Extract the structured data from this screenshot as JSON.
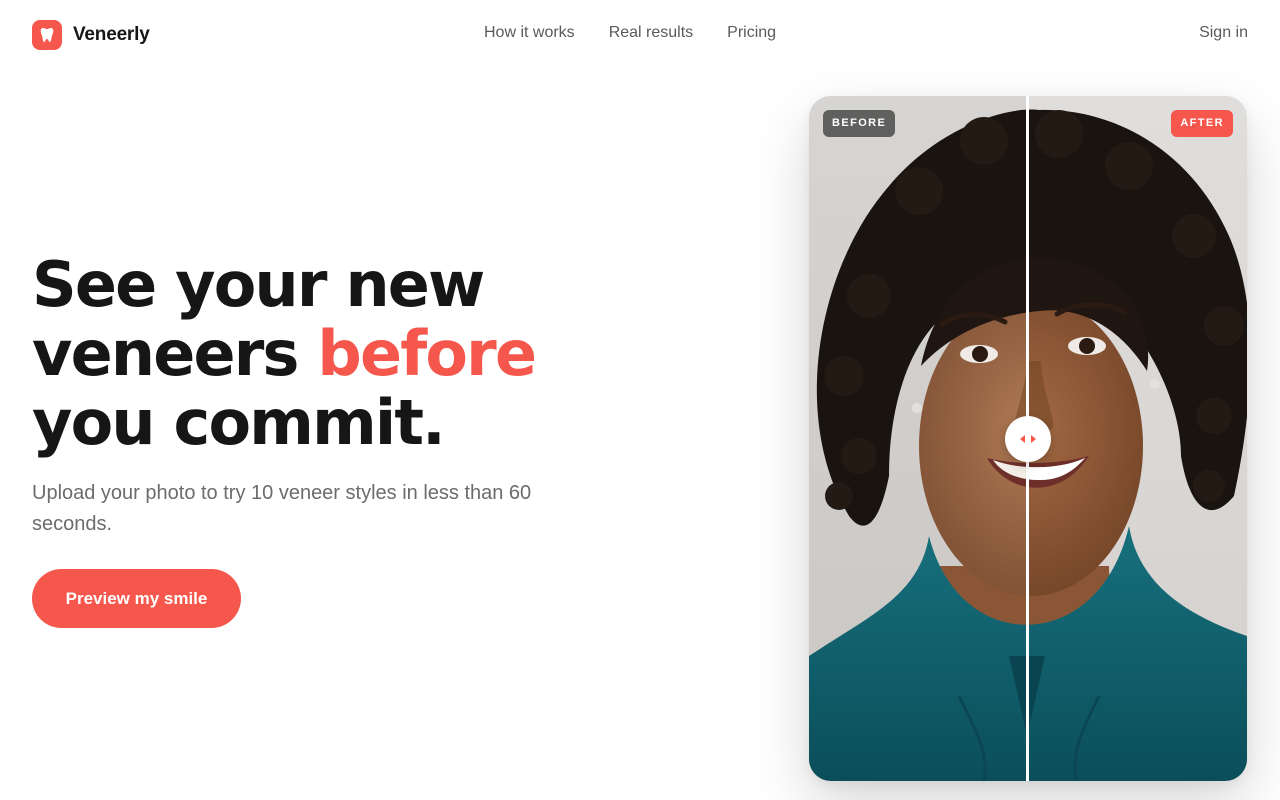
{
  "brand": {
    "name": "Veneerly",
    "icon": "tooth-icon",
    "accent": "#f6574c"
  },
  "nav": {
    "links": [
      "How it works",
      "Real results",
      "Pricing"
    ],
    "sign_in": "Sign in"
  },
  "hero": {
    "title_line1": "See your new",
    "title_line2_start": "veneers ",
    "title_highlight": "before",
    "title_line3": "you commit.",
    "subtitle": "Upload your photo to try 10 veneer styles in less than 60 seconds.",
    "cta": "Preview my smile"
  },
  "comparison": {
    "before_label": "BEFORE",
    "after_label": "AFTER",
    "split_fraction": 0.5,
    "handle_icon": "drag-arrows-icon"
  }
}
